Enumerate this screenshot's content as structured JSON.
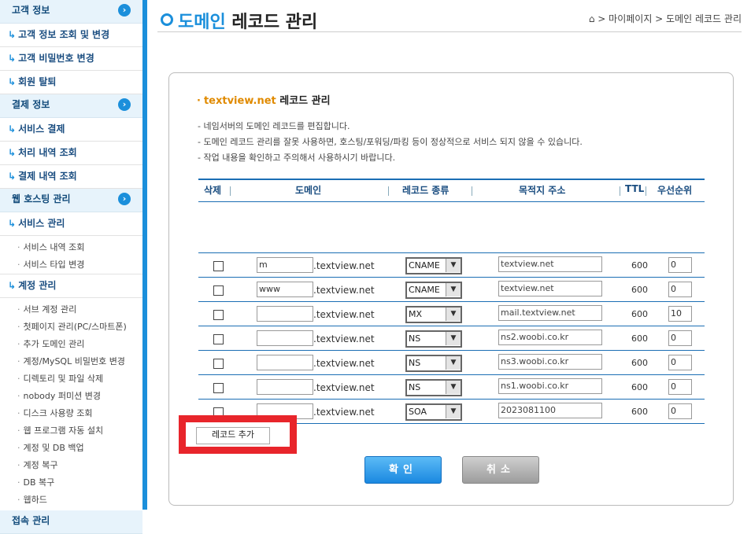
{
  "sidebar": {
    "sections": [
      {
        "label": "고객 정보",
        "items": [
          "고객 정보 조회 및 변경",
          "고객 비밀번호 변경",
          "회원 탈퇴"
        ]
      },
      {
        "label": "결제 정보",
        "items": [
          "서비스 결제",
          "처리 내역 조회",
          "결제 내역 조회"
        ]
      },
      {
        "label": "웹 호스팅 관리",
        "items": [
          "서비스 관리"
        ],
        "subitems_a": [
          "서비스 내역 조회",
          "서비스 타입 변경"
        ],
        "item2": "계정 관리",
        "subitems_b": [
          "서브 계정 관리",
          "첫페이지 관리(PC/스마트폰)",
          "추가 도메인 관리",
          "계정/MySQL 비밀번호 변경",
          "디렉토리 및 파일 삭제",
          "nobody 퍼미션 변경",
          "디스크 사용량 조회",
          "웹 프로그램 자동 설치",
          "계정 및 DB 백업",
          "계정 복구",
          "DB 복구",
          "웹하드"
        ]
      },
      {
        "label": "접속 관리"
      }
    ],
    "arrow": "↳",
    "circle": "›"
  },
  "header": {
    "title_blue": "도메인",
    "title_rest": "레코드 관리",
    "breadcrumb": "⌂ > 마이페이지 > 도메인 레코드 관리"
  },
  "panel": {
    "domain": "textview.net",
    "title_suffix": "레코드 관리",
    "notes": [
      "- 네임서버의 도메인 레코드를 편집합니다.",
      "- 도메인 레코드 관리를 잘못 사용하면, 호스팅/포워딩/파킹 등이 정상적으로 서비스 되지 않을 수 있습니다.",
      "- 작업 내용을 확인하고 주의해서 사용하시기 바랍니다."
    ]
  },
  "table": {
    "headers": {
      "delete": "삭제",
      "domain": "도메인",
      "type": "레코드 종류",
      "dest": "목적지 주소",
      "ttl": "TTL",
      "priority": "우선순위"
    },
    "suffix": ".textview.net",
    "rows": [
      {
        "sub": "m",
        "type": "CNAME",
        "dest": "textview.net",
        "ttl": "600",
        "priority": "0"
      },
      {
        "sub": "www",
        "type": "CNAME",
        "dest": "textview.net",
        "ttl": "600",
        "priority": "0"
      },
      {
        "sub": "",
        "type": "MX",
        "dest": "mail.textview.net",
        "ttl": "600",
        "priority": "10"
      },
      {
        "sub": "",
        "type": "NS",
        "dest": "ns2.woobi.co.kr",
        "ttl": "600",
        "priority": "0"
      },
      {
        "sub": "",
        "type": "NS",
        "dest": "ns3.woobi.co.kr",
        "ttl": "600",
        "priority": "0"
      },
      {
        "sub": "",
        "type": "NS",
        "dest": "ns1.woobi.co.kr",
        "ttl": "600",
        "priority": "0"
      },
      {
        "sub": "",
        "type": "SOA",
        "dest": "2023081100",
        "ttl": "600",
        "priority": "0"
      }
    ]
  },
  "buttons": {
    "add_record": "레코드 추가",
    "confirm": "확인",
    "cancel": "취소"
  }
}
